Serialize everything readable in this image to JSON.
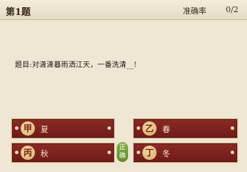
{
  "header": {
    "question_number": "第1题",
    "accuracy_label": "准确率",
    "accuracy_value": "0/2"
  },
  "question": {
    "text": "题目:对潇潇暮雨洒江天，一番洗清__!"
  },
  "options": [
    {
      "badge": "甲",
      "text": "夏"
    },
    {
      "badge": "乙",
      "text": "春"
    },
    {
      "badge": "丙",
      "text": "秋"
    },
    {
      "badge": "丁",
      "text": "冬"
    }
  ],
  "correct_tag": "正确"
}
